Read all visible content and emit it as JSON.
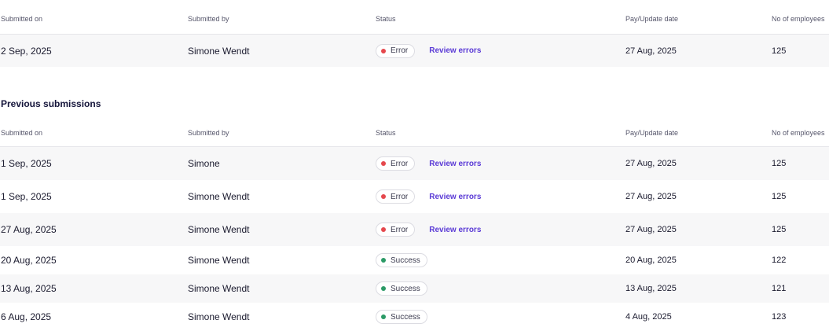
{
  "columns": {
    "submitted_on": "Submitted on",
    "submitted_by": "Submitted by",
    "status": "Status",
    "pay_update_date": "Pay/Update date",
    "no_of_employees": "No of employees"
  },
  "current": {
    "row": {
      "submitted_on": "2 Sep, 2025",
      "submitted_by": "Simone Wendt",
      "status": "Error",
      "status_color": "#e5484d",
      "action": "Review errors",
      "pay_update_date": "27 Aug, 2025",
      "employees": "125"
    }
  },
  "previous": {
    "title": "Previous submissions",
    "rows": [
      {
        "submitted_on": "1 Sep, 2025",
        "submitted_by": "Simone",
        "status": "Error",
        "action": "Review errors",
        "pay_update_date": "27 Aug, 2025",
        "employees": "125"
      },
      {
        "submitted_on": "1 Sep, 2025",
        "submitted_by": "Simone Wendt",
        "status": "Error",
        "action": "Review errors",
        "pay_update_date": "27 Aug, 2025",
        "employees": "125"
      },
      {
        "submitted_on": "27 Aug, 2025",
        "submitted_by": "Simone Wendt",
        "status": "Error",
        "action": "Review errors",
        "pay_update_date": "27 Aug, 2025",
        "employees": "125"
      },
      {
        "submitted_on": "20 Aug, 2025",
        "submitted_by": "Simone Wendt",
        "status": "Success",
        "action": "",
        "pay_update_date": "20 Aug, 2025",
        "employees": "122"
      },
      {
        "submitted_on": "13 Aug, 2025",
        "submitted_by": "Simone Wendt",
        "status": "Success",
        "action": "",
        "pay_update_date": "13 Aug, 2025",
        "employees": "121"
      },
      {
        "submitted_on": "6 Aug, 2025",
        "submitted_by": "Simone Wendt",
        "status": "Success",
        "action": "",
        "pay_update_date": "4 Aug, 2025",
        "employees": "123"
      }
    ]
  },
  "colors": {
    "error": "#e5484d",
    "success": "#2b9a66",
    "link": "#5b3bd6"
  }
}
